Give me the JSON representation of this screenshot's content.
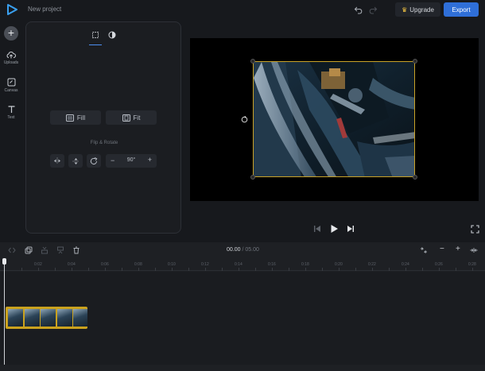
{
  "header": {
    "project_title": "New project",
    "upgrade_label": "Upgrade",
    "export_label": "Export",
    "icons": [
      "play-logo-icon",
      "undo-icon",
      "redo-icon",
      "crown-icon"
    ]
  },
  "rail": {
    "add_symbol": "+",
    "items": [
      {
        "label": "Uploads",
        "icon": "upload-cloud-icon"
      },
      {
        "label": "Canvas",
        "icon": "canvas-icon"
      },
      {
        "label": "Text",
        "icon": "text-icon"
      }
    ]
  },
  "panel": {
    "tabs": [
      "crop-frame-icon",
      "adjust-contrast-icon"
    ],
    "active_tab": 0,
    "fill_label": "Fill",
    "fit_label": "Fit",
    "flip_rotate_title": "Flip & Rotate",
    "rotation": {
      "minus": "−",
      "value": "90°",
      "plus": "+"
    }
  },
  "player": {
    "controls": [
      "skip-back-icon",
      "play-icon",
      "skip-forward-icon",
      "fullscreen-icon"
    ]
  },
  "timeline": {
    "current_time": "00.00",
    "separator": "/",
    "total_time": "05.00",
    "ruler_ticks": [
      "0:02",
      "0:04",
      "0:06",
      "0:08",
      "0:10",
      "0:12",
      "0:14",
      "0:16",
      "0:18",
      "0:20",
      "0:22",
      "0:24",
      "0:26",
      "0:28"
    ],
    "zoom_minus": "−",
    "zoom_plus": "+",
    "clip_thumbnail_count": 5
  },
  "colors": {
    "accent": "#2f6fd8",
    "clip_border": "#caa21e",
    "selection_border": "#c9a227",
    "background": "#17191d"
  }
}
